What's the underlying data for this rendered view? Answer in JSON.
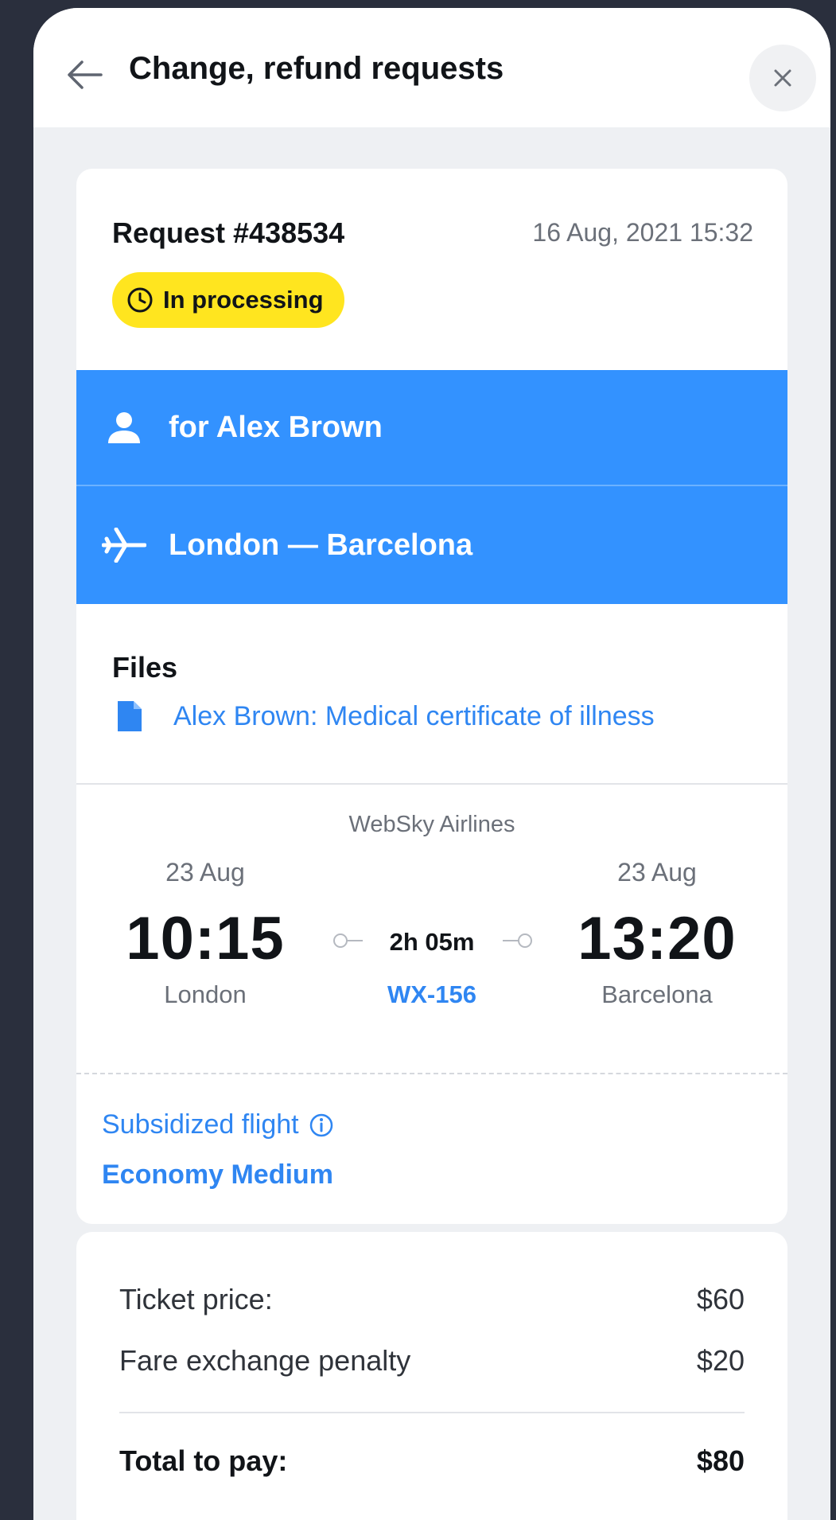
{
  "header": {
    "title": "Change, refund requests"
  },
  "request": {
    "number": "Request #438534",
    "datetime": "16 Aug, 2021 15:32",
    "status": "In processing",
    "passenger": "for Alex Brown",
    "route": "London — Barcelona"
  },
  "files": {
    "title": "Files",
    "items": [
      {
        "label": "Alex Brown: Medical certificate of illness"
      }
    ]
  },
  "flight": {
    "airline": "WebSky Airlines",
    "departure": {
      "date": "23 Aug",
      "time": "10:15",
      "city": "London"
    },
    "arrival": {
      "date": "23 Aug",
      "time": "13:20",
      "city": "Barcelona"
    },
    "duration": "2h 05m",
    "number": "WX-156",
    "subsidized_label": "Subsidized flight",
    "fare_class": "Economy Medium"
  },
  "pricing": {
    "rows": [
      {
        "label": "Ticket price:",
        "value": "$60"
      },
      {
        "label": "Fare exchange penalty",
        "value": "$20"
      }
    ],
    "total": {
      "label": "Total to pay:",
      "value": "$80"
    }
  },
  "colors": {
    "accent_blue": "#3392ff",
    "link_blue": "#2f86f2",
    "status_yellow": "#ffe51f",
    "outer_background": "#2a2f3d"
  },
  "icons": {
    "back": "arrow-left-icon",
    "close": "close-icon",
    "status": "clock-icon",
    "passenger": "person-icon",
    "route": "airplane-icon",
    "file": "document-icon",
    "info": "info-icon"
  }
}
